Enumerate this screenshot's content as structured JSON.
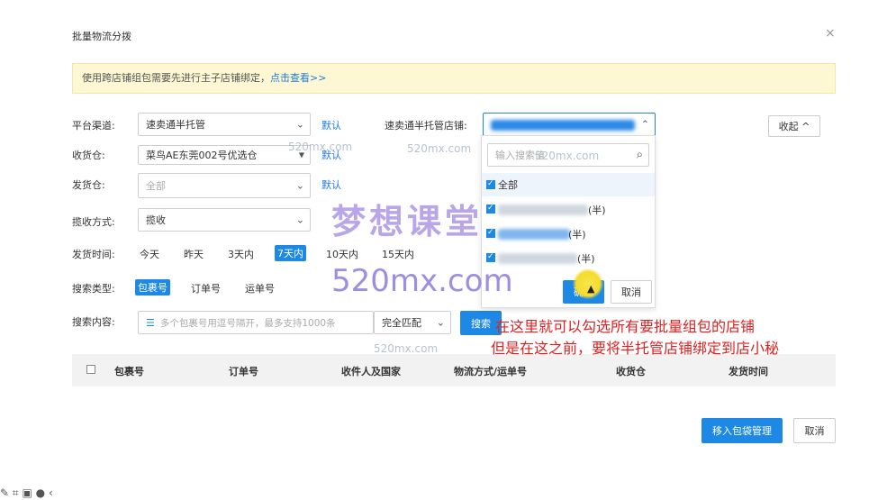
{
  "dialog": {
    "title": "批量物流分拨",
    "close_symbol": "×",
    "notice_text": "使用跨店铺组包需要先进行主子店铺绑定，",
    "notice_link": "点击查看>>"
  },
  "form": {
    "channel_label": "平台渠道:",
    "channel_value": "速卖通半托管",
    "default_link": "默认",
    "store_label": "速卖通半托管店铺:",
    "collapse_label": "收起",
    "receive_label": "收货仓:",
    "receive_value": "菜鸟AE东莞002号优选仓",
    "ship_label": "发货仓:",
    "ship_value": "全部",
    "pickup_label": "揽收方式:",
    "pickup_value": "揽收",
    "time_label": "发货时间:",
    "time_options": [
      "今天",
      "昨天",
      "3天内",
      "7天内",
      "10天内",
      "15天内"
    ],
    "search_type_label": "搜索类型:",
    "search_type_options": [
      "包裹号",
      "订单号",
      "运单号"
    ],
    "search_content_label": "搜索内容:",
    "search_placeholder": "多个包裹号用逗号隔开，最多支持1000条",
    "match_value": "完全匹配",
    "search_button": "搜索"
  },
  "dropdown": {
    "search_placeholder": "输入搜索值",
    "all_label": "全部",
    "item_suffixes": [
      "(半)",
      "(半)",
      "(半)"
    ],
    "confirm_label": "确定",
    "cancel_label": "取消"
  },
  "table": {
    "headers": [
      "包裹号",
      "订单号",
      "收件人及国家",
      "物流方式/运单号",
      "收货仓",
      "发货时间"
    ]
  },
  "footer": {
    "move_button": "移入包袋管理",
    "cancel_button": "取消"
  },
  "annotations": {
    "line1": "在这里就可以勾选所有要批量组包的店铺",
    "line2": "但是在这之前，要将半托管店铺绑定到店小秘"
  },
  "watermark": {
    "small": "520mx.com",
    "cn": "梦想课堂",
    "en": "520mx.com"
  },
  "colors": {
    "primary": "#1e88e5",
    "notice_bg": "#fdf8d3",
    "annotation": "#e02020"
  }
}
